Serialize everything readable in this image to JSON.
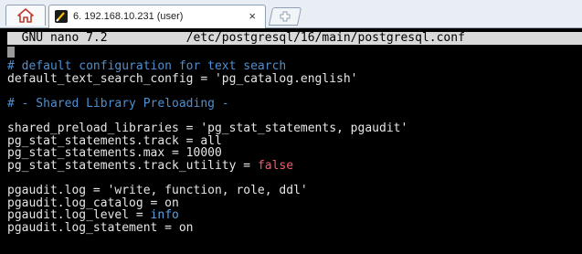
{
  "tabbar": {
    "home_icon": "home-icon",
    "tab_title": "6. 192.168.10.231 (user)",
    "tab_close": "×",
    "new_tab_icon": "new-tab-icon"
  },
  "editor": {
    "title": "  GNU nano 7.2           /etc/postgresql/16/main/postgresql.conf",
    "lines": [
      [
        {
          "t": "# default configuration for text search",
          "c": "comment"
        }
      ],
      [
        {
          "t": "default_text_search_config = 'pg_catalog.english'",
          "c": "plain"
        }
      ],
      [],
      [
        {
          "t": "# - Shared Library Preloading -",
          "c": "comment"
        }
      ],
      [],
      [
        {
          "t": "shared_preload_libraries = 'pg_stat_statements, pgaudit'",
          "c": "plain"
        }
      ],
      [
        {
          "t": "pg_stat_statements.track = all",
          "c": "plain"
        }
      ],
      [
        {
          "t": "pg_stat_statements.max = 10000",
          "c": "plain"
        }
      ],
      [
        {
          "t": "pg_stat_statements.track_utility = ",
          "c": "plain"
        },
        {
          "t": "false",
          "c": "red"
        }
      ],
      [],
      [
        {
          "t": "pgaudit.log = 'write, function, role, ddl'",
          "c": "plain"
        }
      ],
      [
        {
          "t": "pgaudit.log_catalog = on",
          "c": "plain"
        }
      ],
      [
        {
          "t": "pgaudit.log_level = ",
          "c": "plain"
        },
        {
          "t": "info",
          "c": "blue"
        }
      ],
      [
        {
          "t": "pgaudit.log_statement = on",
          "c": "plain"
        }
      ]
    ]
  }
}
